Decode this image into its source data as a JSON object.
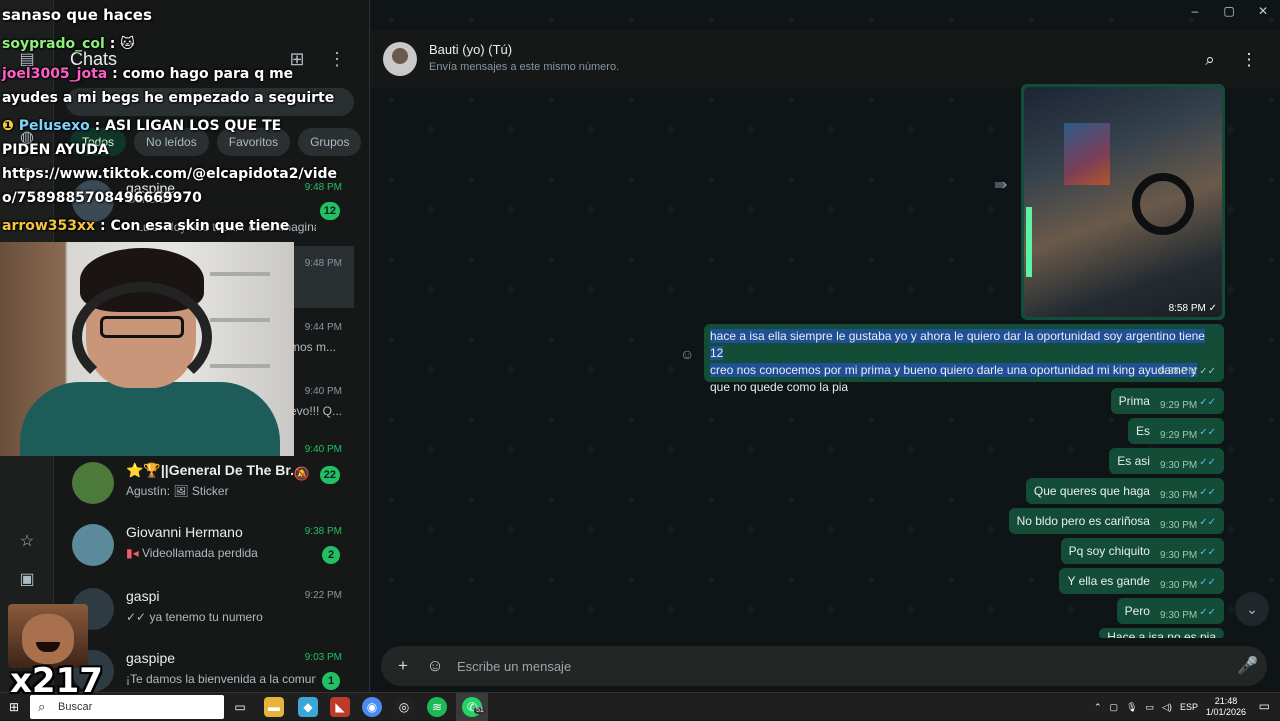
{
  "window": {
    "minimize": "–",
    "maximize": "▢",
    "close": "✕"
  },
  "panel": {
    "title": "Chats",
    "filters": [
      "Todos",
      "No leídos",
      "Favoritos",
      "Grupos"
    ],
    "chats": [
      {
        "name": "gaspipe",
        "sub": "General",
        "preview": "~ Luis: Hoy nos toca... debe imaginar ...",
        "time": "9:48 PM",
        "badge": "12"
      },
      {
        "name": "",
        "preview": "",
        "time": "9:48 PM",
        "badge": ""
      },
      {
        "name": "",
        "preview": "mos m...",
        "time": "9:44 PM",
        "badge": ""
      },
      {
        "name": "",
        "preview": "evo!!! Q...",
        "time": "9:40 PM",
        "badge": ""
      },
      {
        "name": "",
        "preview": "",
        "time": "9:40 PM",
        "badge": ""
      },
      {
        "name": "⭐🏆||General De The Br...",
        "preview": "Agustín: 🖼 Sticker",
        "time": "",
        "badge": "22"
      },
      {
        "name": "Giovanni Hermano",
        "preview": "Videollamada perdida",
        "time": "9:38 PM",
        "badge": "2"
      },
      {
        "name": "gaspi",
        "preview": "✓✓ ya tenemo tu numero",
        "time": "9:22 PM",
        "badge": ""
      },
      {
        "name": "gaspipe",
        "preview": "¡Te damos la bienvenida a la comun...",
        "time": "9:03 PM",
        "badge": "1"
      }
    ]
  },
  "conversation": {
    "name": "Bauti (yo) (Tú)",
    "subtitle": "Envía mensajes a este mismo número.",
    "image_time": "8:58 PM",
    "long_message": {
      "text_a": "hace a isa ella siempre le gustaba yo y ahora le quiero dar la oportunidad soy argentino tiene 12",
      "text_b": "creo nos conocemos por mi prima y  bueno quiero darle una oportunidad mi king ayudame y",
      "text_c": "que no quede como la pia",
      "time": "9:28 PM"
    },
    "messages": [
      {
        "text": "Prima",
        "time": "9:29 PM"
      },
      {
        "text": "Es",
        "time": "9:29 PM"
      },
      {
        "text": "Es asi",
        "time": "9:30 PM"
      },
      {
        "text": "Que queres que haga",
        "time": "9:30 PM"
      },
      {
        "text": "No bldo pero es cariñosa",
        "time": "9:30 PM"
      },
      {
        "text": "Pq soy chiquito",
        "time": "9:30 PM"
      },
      {
        "text": "Y ella es gande",
        "time": "9:30 PM"
      },
      {
        "text": "Pero",
        "time": "9:30 PM"
      },
      {
        "text": "Hace a isa no es pia",
        "time": ""
      }
    ],
    "composer_placeholder": "Escribe un mensaje"
  },
  "overlay": {
    "title": "sanaso que haces",
    "lines": [
      {
        "user": "soyprado_col",
        "text": ": 🐱"
      },
      {
        "user": "joel3005_jota",
        "text": ": como hago para q me"
      },
      {
        "user": "",
        "text": "ayudes a mi begs he empezado a seguirte"
      },
      {
        "user": "Pelusexo",
        "text": ": ASI LIGAN LOS QUE TE"
      },
      {
        "user": "",
        "text": "PIDEN AYUDA"
      },
      {
        "user": "",
        "text": "https://www.tiktok.com/@elcapidota2/vide"
      },
      {
        "user": "",
        "text": "o/7589885708496669970"
      },
      {
        "user": "arrow353xx",
        "text": ": Con esa skin que tiene"
      }
    ],
    "emote_count": "x217"
  },
  "taskbar": {
    "search": "Buscar",
    "whatsapp_badge": "51",
    "lang": "ESP",
    "time": "21:48",
    "date": "1/01/2026"
  }
}
